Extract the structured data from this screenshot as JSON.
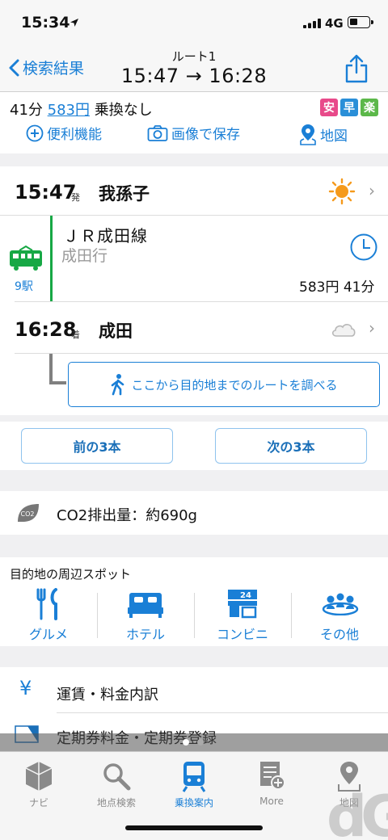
{
  "status": {
    "time": "15:34",
    "network": "4G"
  },
  "nav": {
    "back_label": "検索結果",
    "title": "ルート1",
    "subtitle": "15:47 → 16:28"
  },
  "summary": {
    "duration": "41分",
    "fare": "583円",
    "transfer": "乗換なし",
    "badges": [
      {
        "label": "安",
        "color": "#e84a8a"
      },
      {
        "label": "早",
        "color": "#2a8fd8"
      },
      {
        "label": "楽",
        "color": "#5cb84a"
      }
    ],
    "actions": {
      "tools": "便利機能",
      "save_image": "画像で保存",
      "map": "地図"
    }
  },
  "route": {
    "depart": {
      "time": "15:47",
      "suffix": "発",
      "station": "我孫子",
      "weather": "sunny-icon"
    },
    "segment": {
      "line": "ＪＲ成田線",
      "destination": "成田行",
      "stops": "9駅",
      "fare": "583円",
      "duration": "41分"
    },
    "arrive": {
      "time": "16:28",
      "suffix": "着",
      "station": "成田",
      "weather": "cloudy-icon"
    },
    "search_link": "ここから目的地までのルートを調べる"
  },
  "prev_next": {
    "prev": "前の3本",
    "next": "次の3本"
  },
  "co2": {
    "text": "CO2排出量：約690g",
    "icon_text": "CO2"
  },
  "spots": {
    "title": "目的地の周辺スポット",
    "items": [
      {
        "label": "グルメ",
        "icon": "gourmet-icon"
      },
      {
        "label": "ホテル",
        "icon": "hotel-icon"
      },
      {
        "label": "コンビニ",
        "icon": "convenience-store-icon"
      },
      {
        "label": "その他",
        "icon": "others-icon"
      }
    ],
    "conv_badge": "24"
  },
  "links": {
    "fare_detail": "運賃・料金内訳",
    "commuter": "定期券料金・定期券登録",
    "yen_symbol": "¥"
  },
  "tabs": [
    {
      "label": "ナビ",
      "active": false
    },
    {
      "label": "地点検索",
      "active": false
    },
    {
      "label": "乗換案内",
      "active": true
    },
    {
      "label": "More",
      "active": false
    },
    {
      "label": "地図",
      "active": false
    }
  ],
  "colors": {
    "accent": "#1a7fd6",
    "train_green": "#17a845",
    "sun": "#f59a1c"
  }
}
